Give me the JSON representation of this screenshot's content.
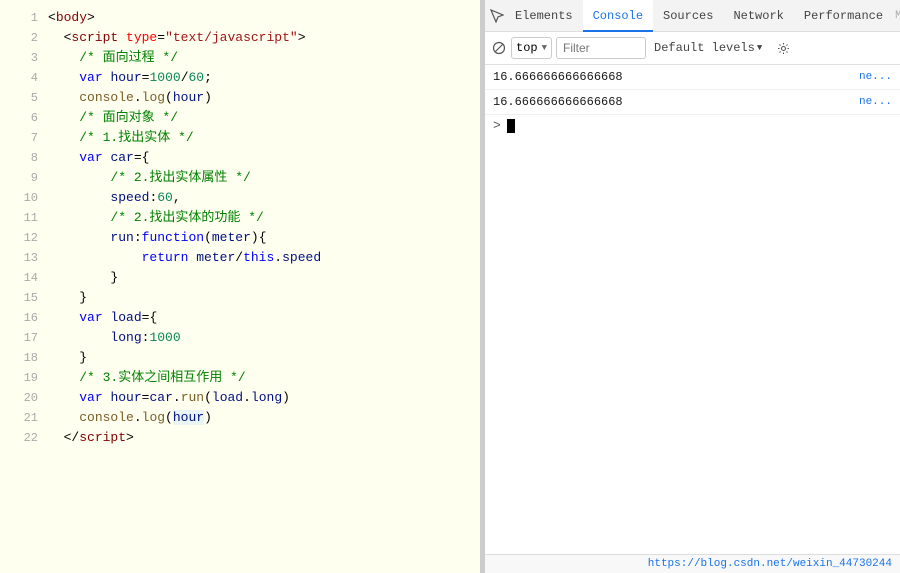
{
  "code": {
    "lines": [
      {
        "num": 1,
        "html": "<span class='plain'>&lt;<span class='tag'>body</span>&gt;</span>"
      },
      {
        "num": 2,
        "html": "  &lt;<span class='tag'>script</span> <span class='attr'>type</span>=<span class='str'>\"text/javascript\"</span>&gt;"
      },
      {
        "num": 3,
        "html": "    <span class='comment'>/* 面向过程 */</span>"
      },
      {
        "num": 4,
        "html": "    <span class='kw'>var</span> <span class='var-name'>hour</span>=<span class='num'>1000</span>/<span class='num'>60</span>;"
      },
      {
        "num": 5,
        "html": "    <span class='fn'>console</span>.<span class='method'>log</span>(<span class='var-name'>hour</span>)"
      },
      {
        "num": 6,
        "html": "    <span class='comment'>/* 面向对象 */</span>"
      },
      {
        "num": 7,
        "html": "    <span class='comment'>/* 1.找出实体 */</span>"
      },
      {
        "num": 8,
        "html": "    <span class='kw'>var</span> <span class='var-name'>car</span>={"
      },
      {
        "num": 9,
        "html": "        <span class='comment'>/* 2.找出实体属性 */</span>"
      },
      {
        "num": 10,
        "html": "        <span class='prop'>speed</span>:<span class='num'>60</span>,"
      },
      {
        "num": 11,
        "html": "        <span class='comment'>/* 2.找出实体的功能 */</span>"
      },
      {
        "num": 12,
        "html": "        <span class='prop'>run</span>:<span class='kw'>function</span>(<span class='var-name'>meter</span>){"
      },
      {
        "num": 13,
        "html": "            <span class='kw'>return</span> <span class='var-name'>meter</span>/<span class='this-kw'>this</span>.<span class='prop'>speed</span>"
      },
      {
        "num": 14,
        "html": "        }"
      },
      {
        "num": 15,
        "html": "    }"
      },
      {
        "num": 16,
        "html": "    <span class='kw'>var</span> <span class='var-name'>load</span>={"
      },
      {
        "num": 17,
        "html": "        <span class='prop'>long</span>:<span class='num'>1000</span>"
      },
      {
        "num": 18,
        "html": "    }"
      },
      {
        "num": 19,
        "html": "    <span class='comment'>/* 3.实体之间相互作用 */</span>"
      },
      {
        "num": 20,
        "html": "    <span class='kw'>var</span> <span class='var-name'>hour</span>=<span class='var-name'>car</span>.<span class='method'>run</span>(<span class='var-name'>load</span>.<span class='prop'>long</span>)"
      },
      {
        "num": 21,
        "html": "    <span class='fn'>console</span>.<span class='method'>log</span>(<span class='var-name highlight-bg'>hour</span>)"
      },
      {
        "num": 22,
        "html": "  &lt;/<span class='tag'>script</span>&gt;"
      }
    ]
  },
  "devtools": {
    "tabs": [
      "Elements",
      "Console",
      "Sources",
      "Network",
      "Performance",
      "Memory"
    ],
    "active_tab": "Console",
    "console": {
      "top_label": "top",
      "filter_placeholder": "Filter",
      "default_levels_label": "Default levels",
      "entries": [
        {
          "value": "16.666666666666668",
          "source": "ne..."
        },
        {
          "value": "16.666666666666668",
          "source": "ne..."
        }
      ],
      "input_prompt": ">"
    },
    "footer_url": "https://blog.csdn.net/weixin_44730244"
  }
}
